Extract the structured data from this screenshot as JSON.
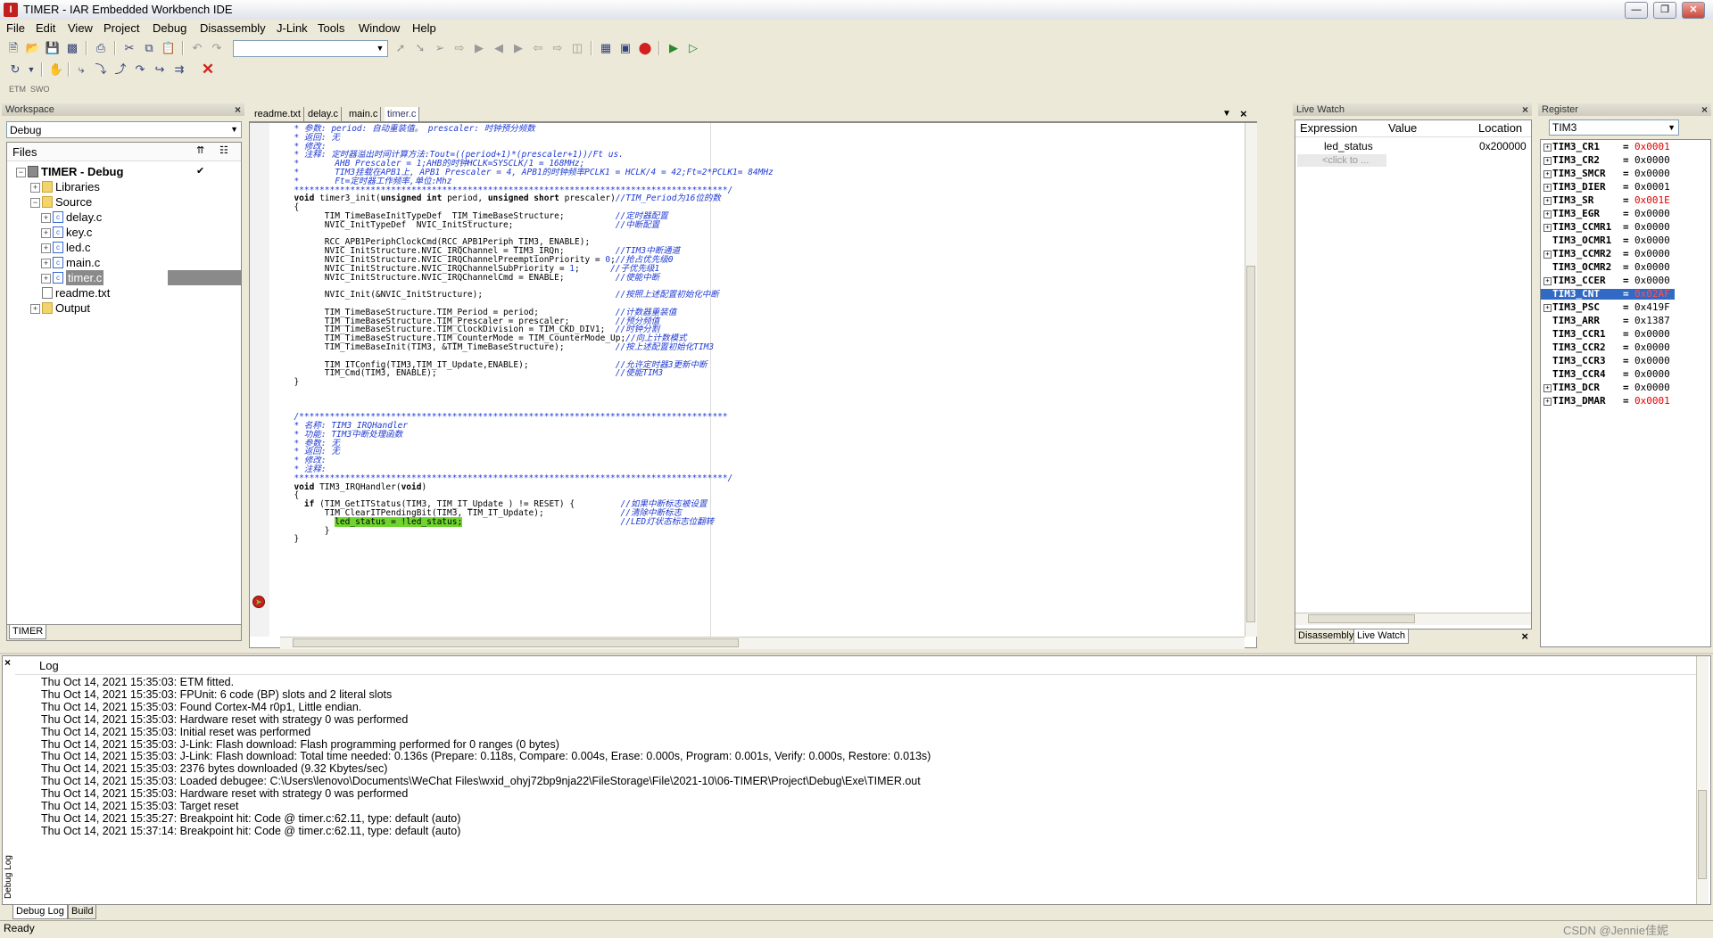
{
  "window": {
    "title": "TIMER - IAR Embedded Workbench IDE",
    "app_icon": "iar-logo-icon"
  },
  "menu": [
    "File",
    "Edit",
    "View",
    "Project",
    "Debug",
    "Disassembly",
    "J-Link",
    "Tools",
    "Window",
    "Help"
  ],
  "toolbar": {
    "etm_label": "ETM",
    "swo_label": "SWO"
  },
  "workspace": {
    "title": "Workspace",
    "config": "Debug",
    "files_header": "Files",
    "tab": "TIMER",
    "tree": [
      {
        "label": "TIMER - Debug",
        "level": 0,
        "type": "project",
        "expander": "−",
        "bold": true,
        "check": "✔"
      },
      {
        "label": "Libraries",
        "level": 1,
        "type": "folder",
        "expander": "+"
      },
      {
        "label": "Source",
        "level": 1,
        "type": "folder",
        "expander": "−"
      },
      {
        "label": "delay.c",
        "level": 2,
        "type": "c",
        "expander": "+"
      },
      {
        "label": "key.c",
        "level": 2,
        "type": "c",
        "expander": "+"
      },
      {
        "label": "led.c",
        "level": 2,
        "type": "c",
        "expander": "+"
      },
      {
        "label": "main.c",
        "level": 2,
        "type": "c",
        "expander": "+"
      },
      {
        "label": "timer.c",
        "level": 2,
        "type": "c",
        "expander": "+",
        "selected": true
      },
      {
        "label": "readme.txt",
        "level": 1,
        "type": "txt",
        "expander": ""
      },
      {
        "label": "Output",
        "level": 1,
        "type": "folder",
        "expander": "+"
      }
    ]
  },
  "editor": {
    "tabs": [
      "readme.txt",
      "delay.c",
      "main.c",
      "timer.c"
    ],
    "active_tab": 3
  },
  "live_watch": {
    "title": "Live Watch",
    "columns": [
      "Expression",
      "Value",
      "Location"
    ],
    "rows": [
      {
        "expression": "led_status",
        "value": "",
        "location": "0x200000"
      }
    ],
    "placeholder": "<click to ...",
    "tabs": [
      "Disassembly",
      "Live Watch"
    ]
  },
  "register": {
    "title": "Register",
    "group": "TIM3",
    "rows": [
      {
        "name": "TIM3_CR1",
        "value": "0x0001",
        "changed": true,
        "expander": true
      },
      {
        "name": "TIM3_CR2",
        "value": "0x0000",
        "changed": false,
        "expander": true
      },
      {
        "name": "TIM3_SMCR",
        "value": "0x0000",
        "changed": false,
        "expander": true
      },
      {
        "name": "TIM3_DIER",
        "value": "0x0001",
        "changed": false,
        "expander": true
      },
      {
        "name": "TIM3_SR",
        "value": "0x001E",
        "changed": true,
        "expander": true
      },
      {
        "name": "TIM3_EGR",
        "value": "0x0000",
        "changed": false,
        "expander": true
      },
      {
        "name": "TIM3_CCMR1",
        "value": "0x0000",
        "changed": false,
        "expander": true
      },
      {
        "name": "TIM3_OCMR1",
        "value": "0x0000",
        "changed": false,
        "expander": false
      },
      {
        "name": "TIM3_CCMR2",
        "value": "0x0000",
        "changed": false,
        "expander": true
      },
      {
        "name": "TIM3_OCMR2",
        "value": "0x0000",
        "changed": false,
        "expander": false
      },
      {
        "name": "TIM3_CCER",
        "value": "0x0000",
        "changed": false,
        "expander": true
      },
      {
        "name": "TIM3_CNT",
        "value": "0x02AF",
        "changed": true,
        "expander": false,
        "selected": true
      },
      {
        "name": "TIM3_PSC",
        "value": "0x419F",
        "changed": false,
        "expander": true
      },
      {
        "name": "TIM3_ARR",
        "value": "0x1387",
        "changed": false,
        "expander": false
      },
      {
        "name": "TIM3_CCR1",
        "value": "0x0000",
        "changed": false,
        "expander": false
      },
      {
        "name": "TIM3_CCR2",
        "value": "0x0000",
        "changed": false,
        "expander": false
      },
      {
        "name": "TIM3_CCR3",
        "value": "0x0000",
        "changed": false,
        "expander": false
      },
      {
        "name": "TIM3_CCR4",
        "value": "0x0000",
        "changed": false,
        "expander": false
      },
      {
        "name": "TIM3_DCR",
        "value": "0x0000",
        "changed": false,
        "expander": true
      },
      {
        "name": "TIM3_DMAR",
        "value": "0x0001",
        "changed": true,
        "expander": true
      }
    ]
  },
  "log": {
    "header": "Log",
    "side_label": "Debug Log",
    "tabs": [
      "Debug Log",
      "Build"
    ],
    "lines": [
      "Thu Oct 14, 2021 15:35:03: ETM fitted.",
      "Thu Oct 14, 2021 15:35:03: FPUnit: 6 code (BP) slots and 2 literal slots",
      "Thu Oct 14, 2021 15:35:03: Found Cortex-M4 r0p1, Little endian.",
      "Thu Oct 14, 2021 15:35:03: Hardware reset with strategy 0 was performed",
      "Thu Oct 14, 2021 15:35:03: Initial reset was performed",
      "Thu Oct 14, 2021 15:35:03: J-Link: Flash download: Flash programming performed for 0 ranges (0 bytes)",
      "Thu Oct 14, 2021 15:35:03: J-Link: Flash download: Total time needed: 0.136s (Prepare: 0.118s, Compare: 0.004s, Erase: 0.000s, Program: 0.001s, Verify: 0.000s, Restore: 0.013s)",
      "Thu Oct 14, 2021 15:35:03: 2376 bytes downloaded (9.32 Kbytes/sec)",
      "Thu Oct 14, 2021 15:35:03: Loaded debugee: C:\\Users\\lenovo\\Documents\\WeChat Files\\wxid_ohyj72bp9nja22\\FileStorage\\File\\2021-10\\06-TIMER\\Project\\Debug\\Exe\\TIMER.out",
      "Thu Oct 14, 2021 15:35:03: Hardware reset with strategy 0 was performed",
      "Thu Oct 14, 2021 15:35:03: Target reset",
      "Thu Oct 14, 2021 15:35:27: Breakpoint hit: Code @ timer.c:62.11, type: default (auto)",
      "Thu Oct 14, 2021 15:37:14: Breakpoint hit: Code @ timer.c:62.11, type: default (auto)"
    ]
  },
  "status": {
    "text": "Ready",
    "watermark": "CSDN @Jennie佳妮"
  },
  "colors": {
    "changed_value": "#e00000",
    "selected_row": "#316ac5",
    "comment": "#1f3ad1",
    "current_line": "#6ed42f"
  }
}
